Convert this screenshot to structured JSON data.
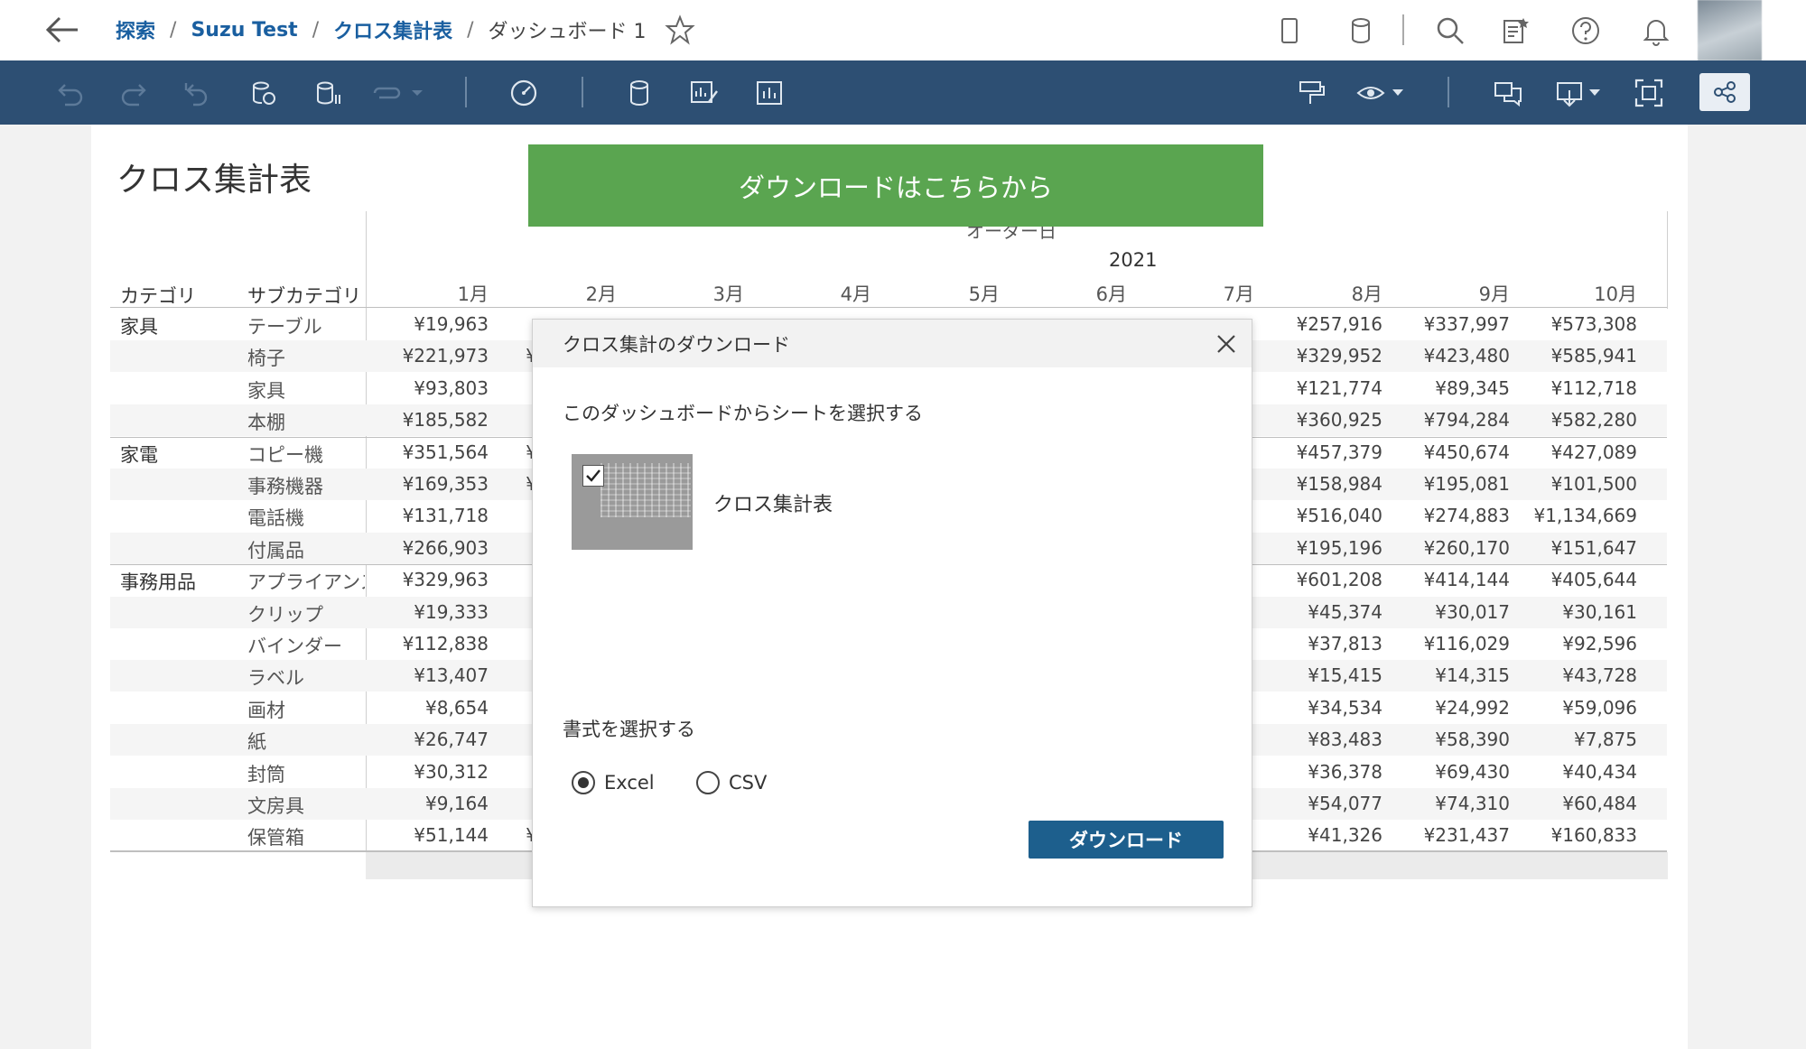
{
  "breadcrumb": {
    "items": [
      "探索",
      "Suzu Test",
      "クロス集計表"
    ],
    "separator": "/",
    "current": "ダッシュボード 1"
  },
  "icons": {
    "top": [
      "back-icon",
      "star-icon",
      "tablet-icon",
      "datasource-icon",
      "search-icon",
      "custom-views-icon",
      "help-icon",
      "notification-icon"
    ],
    "toolbar": [
      "undo-icon",
      "redo-icon",
      "revert-icon",
      "refresh-icon",
      "pause-updates-icon",
      "replay-icon",
      "metrics-icon",
      "data-source-icon",
      "edit-icon",
      "view-data-icon",
      "highlight-icon",
      "watch-icon",
      "comments-icon",
      "download-icon",
      "fullscreen-icon",
      "share-icon"
    ]
  },
  "sheet": {
    "title": "クロス集計表",
    "banner": "ダウンロードはこちらから",
    "order_date_label": "オーダー日",
    "year": "2021",
    "dim_headers": [
      "カテゴリ",
      "サブカテゴリ"
    ],
    "months": [
      "1月",
      "2月",
      "3月",
      "4月",
      "5月",
      "6月",
      "7月",
      "8月",
      "9月",
      "10月"
    ],
    "rows": [
      {
        "cat": "家具",
        "sub": "テーブル",
        "m1": "¥19,963",
        "m2": "",
        "m8": "¥257,916",
        "m9": "¥337,997",
        "m10": "¥573,308"
      },
      {
        "cat": "",
        "sub": "椅子",
        "m1": "¥221,973",
        "m2": "¥",
        "m8": "¥329,952",
        "m9": "¥423,480",
        "m10": "¥585,941"
      },
      {
        "cat": "",
        "sub": "家具",
        "m1": "¥93,803",
        "m2": "",
        "m8": "¥121,774",
        "m9": "¥89,345",
        "m10": "¥112,718"
      },
      {
        "cat": "",
        "sub": "本棚",
        "m1": "¥185,582",
        "m2": "",
        "m8": "¥360,925",
        "m9": "¥794,284",
        "m10": "¥582,280"
      },
      {
        "cat": "家電",
        "sub": "コピー機",
        "m1": "¥351,564",
        "m2": "¥",
        "m8": "¥457,379",
        "m9": "¥450,674",
        "m10": "¥427,089"
      },
      {
        "cat": "",
        "sub": "事務機器",
        "m1": "¥169,353",
        "m2": "¥",
        "m8": "¥158,984",
        "m9": "¥195,081",
        "m10": "¥101,500"
      },
      {
        "cat": "",
        "sub": "電話機",
        "m1": "¥131,718",
        "m2": "",
        "m8": "¥516,040",
        "m9": "¥274,883",
        "m10": "¥1,134,669"
      },
      {
        "cat": "",
        "sub": "付属品",
        "m1": "¥266,903",
        "m2": "",
        "m8": "¥195,196",
        "m9": "¥260,170",
        "m10": "¥151,647"
      },
      {
        "cat": "事務用品",
        "sub": "アプライアンス",
        "m1": "¥329,963",
        "m2": "",
        "m8": "¥601,208",
        "m9": "¥414,144",
        "m10": "¥405,644"
      },
      {
        "cat": "",
        "sub": "クリップ",
        "m1": "¥19,333",
        "m2": "",
        "m8": "¥45,374",
        "m9": "¥30,017",
        "m10": "¥30,161"
      },
      {
        "cat": "",
        "sub": "バインダー",
        "m1": "¥112,838",
        "m2": "",
        "m8": "¥37,813",
        "m9": "¥116,029",
        "m10": "¥92,596"
      },
      {
        "cat": "",
        "sub": "ラベル",
        "m1": "¥13,407",
        "m2": "",
        "m8": "¥15,415",
        "m9": "¥14,315",
        "m10": "¥43,728"
      },
      {
        "cat": "",
        "sub": "画材",
        "m1": "¥8,654",
        "m2": "",
        "m8": "¥34,534",
        "m9": "¥24,992",
        "m10": "¥59,096"
      },
      {
        "cat": "",
        "sub": "紙",
        "m1": "¥26,747",
        "m2": "",
        "m8": "¥83,483",
        "m9": "¥58,390",
        "m10": "¥7,875"
      },
      {
        "cat": "",
        "sub": "封筒",
        "m1": "¥30,312",
        "m2": "",
        "m8": "¥36,378",
        "m9": "¥69,430",
        "m10": "¥40,434"
      },
      {
        "cat": "",
        "sub": "文房具",
        "m1": "¥9,164",
        "m2": "",
        "m8": "¥54,077",
        "m9": "¥74,310",
        "m10": "¥60,484"
      },
      {
        "cat": "",
        "sub": "保管箱",
        "m1": "¥51,144",
        "m2": "¥",
        "m8": "¥41,326",
        "m9": "¥231,437",
        "m10": "¥160,833"
      }
    ]
  },
  "dialog": {
    "title": "クロス集計のダウンロード",
    "subtitle": "このダッシュボードからシートを選択する",
    "sheet_name": "クロス集計表",
    "sheet_checked": true,
    "format_label": "書式を選択する",
    "formats": [
      "Excel",
      "CSV"
    ],
    "selected_format": "Excel",
    "download_label": "ダウンロード"
  },
  "colors": {
    "toolbar": "#2d4f73",
    "banner": "#5aa550",
    "download_button": "#1d5f8d",
    "breadcrumb_link": "#1a5fa0"
  }
}
